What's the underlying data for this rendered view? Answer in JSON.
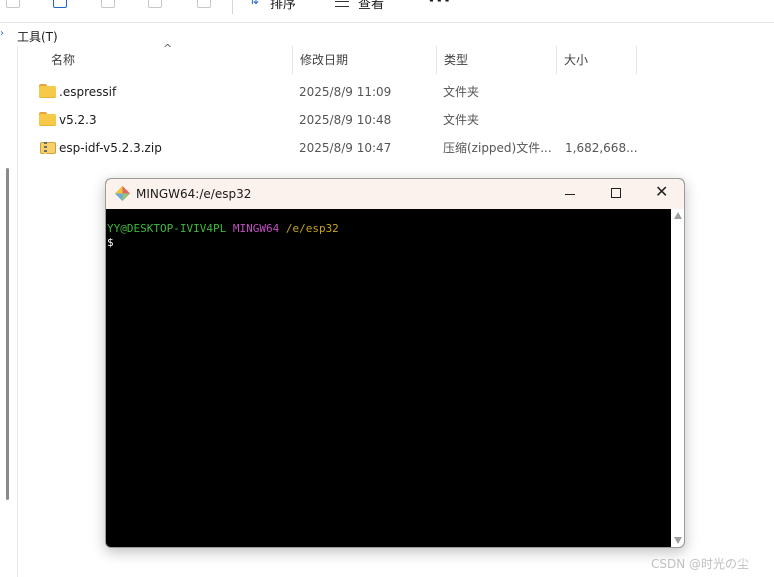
{
  "toolbar": {
    "sort_label": "排序",
    "view_label": "查看",
    "more_label": "···"
  },
  "menu": {
    "tools_label": "工具(T)"
  },
  "columns": {
    "name": "名称",
    "modified": "修改日期",
    "type": "类型",
    "size": "大小"
  },
  "files": [
    {
      "name": ".espressif",
      "modified": "2025/8/9 11:09",
      "type": "文件夹",
      "size": "",
      "icon": "folder-icon"
    },
    {
      "name": "v5.2.3",
      "modified": "2025/8/9 10:48",
      "type": "文件夹",
      "size": "",
      "icon": "folder-icon"
    },
    {
      "name": "esp-idf-v5.2.3.zip",
      "modified": "2025/8/9 10:47",
      "type": "压缩(zipped)文件...",
      "size": "1,682,668...",
      "icon": "zip-icon"
    }
  ],
  "terminal": {
    "title": "MINGW64:/e/esp32",
    "prompt_user": "YY@DESKTOP-IVIV4PL",
    "prompt_env": "MINGW64",
    "prompt_path": "/e/esp32",
    "prompt_symbol": "$",
    "colors": {
      "user": "#3fb93f",
      "env": "#c24fc2",
      "path": "#c6a61d",
      "background": "#000000"
    }
  },
  "watermark": "CSDN @时光の尘"
}
